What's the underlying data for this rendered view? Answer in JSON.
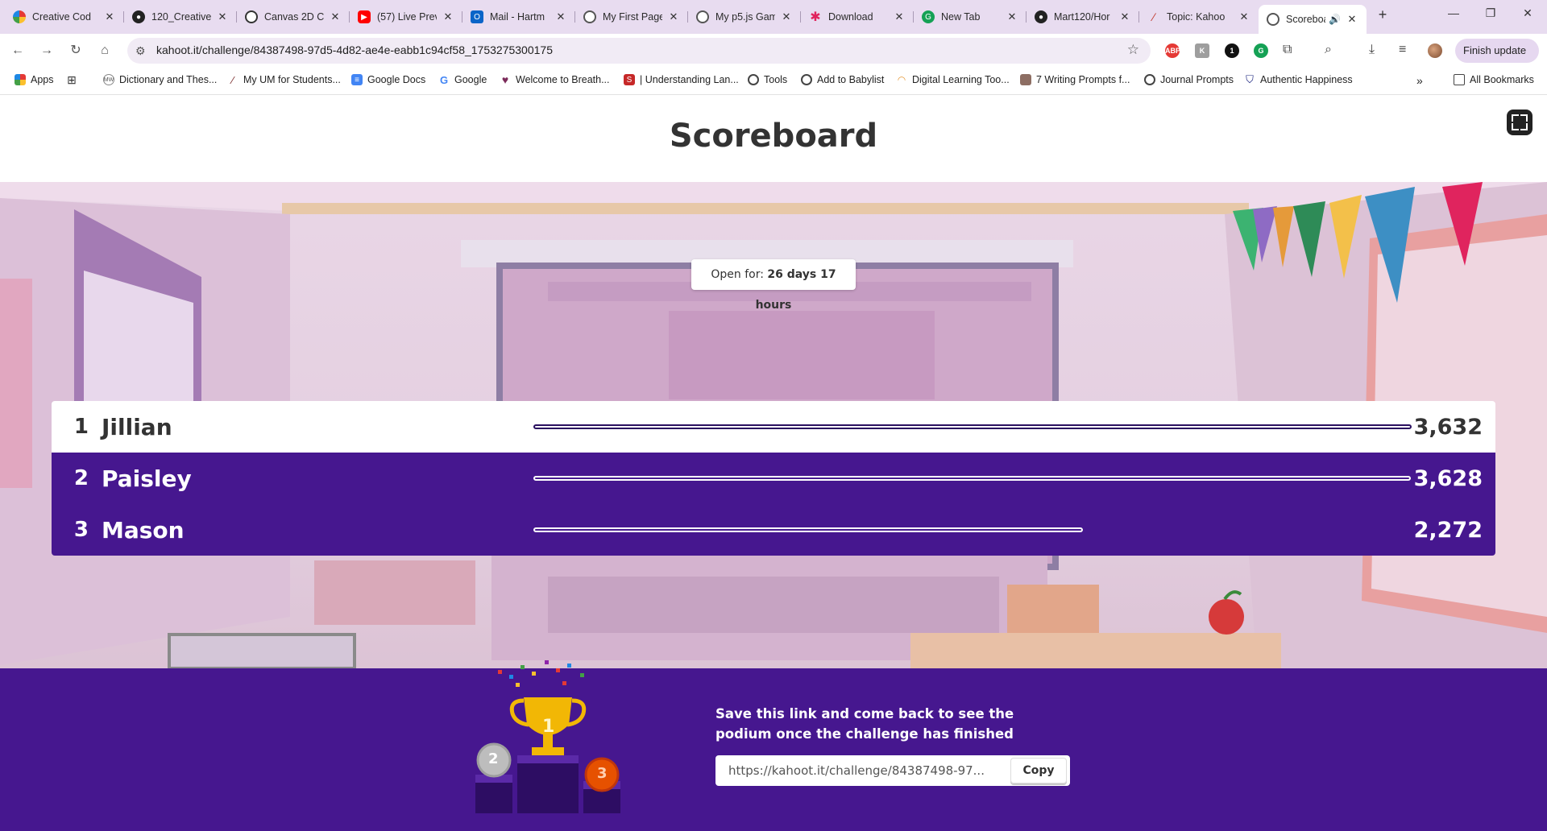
{
  "browser": {
    "tabs": [
      {
        "label": "Creative Cod",
        "icon": "multicolor-logo-icon",
        "color": "#e05a2b"
      },
      {
        "label": "120_Creative",
        "icon": "github-icon",
        "color": "#222222"
      },
      {
        "label": "Canvas 2D C",
        "icon": "openai-icon",
        "color": "#333333"
      },
      {
        "label": "(57) Live Prev",
        "icon": "youtube-icon",
        "color": "#ff0000"
      },
      {
        "label": "Mail - Hartm",
        "icon": "outlook-icon",
        "color": "#0a64c8"
      },
      {
        "label": "My First Page",
        "icon": "globe-icon",
        "color": "#444444"
      },
      {
        "label": "My p5.js Gam",
        "icon": "globe-icon",
        "color": "#444444"
      },
      {
        "label": "Download",
        "icon": "asterisk-icon",
        "color": "#e0245e"
      },
      {
        "label": "New Tab",
        "icon": "grammarly-icon",
        "color": "#15a155"
      },
      {
        "label": "Mart120/Hor",
        "icon": "github-icon",
        "color": "#222222"
      },
      {
        "label": "Topic: Kahoo",
        "icon": "canvas-icon",
        "color": "#c0392b"
      },
      {
        "label": "Scoreboa",
        "icon": "globe-icon",
        "color": "#444444",
        "active": true
      }
    ],
    "url": "kahoot.it/challenge/84387498-97d5-4d82-ae4e-eabb1c94cf58_1753275300175",
    "finish_update": "Finish update",
    "bookmarks": [
      {
        "label": "Apps",
        "icon": "apps-grid-icon"
      },
      {
        "label": "",
        "icon": "grid-icon"
      },
      {
        "label": "Dictionary and Thes...",
        "icon": "mw-icon"
      },
      {
        "label": "My UM for Students...",
        "icon": "um-icon"
      },
      {
        "label": "Google Docs",
        "icon": "docs-icon"
      },
      {
        "label": "Google",
        "icon": "google-icon"
      },
      {
        "label": "Welcome to Breath...",
        "icon": "heart-icon"
      },
      {
        "label": "| Understanding Lan...",
        "icon": "s-icon"
      },
      {
        "label": "Tools",
        "icon": "globe-icon"
      },
      {
        "label": "Add to Babylist",
        "icon": "globe-icon"
      },
      {
        "label": "Digital Learning Too...",
        "icon": "rainbow-icon"
      },
      {
        "label": "7 Writing Prompts f...",
        "icon": "photo-icon"
      },
      {
        "label": "Journal Prompts",
        "icon": "globe-icon"
      },
      {
        "label": "Authentic Happiness",
        "icon": "shield-icon"
      }
    ],
    "all_bookmarks": "All Bookmarks"
  },
  "page": {
    "title": "Scoreboard",
    "open_prefix": "Open for: ",
    "open_duration": "26 days 17 hours",
    "players": [
      {
        "rank": "1",
        "name": "Jillian",
        "score": "3,632",
        "fraction": 1.0
      },
      {
        "rank": "2",
        "name": "Paisley",
        "score": "3,628",
        "fraction": 0.999
      },
      {
        "rank": "3",
        "name": "Mason",
        "score": "2,272",
        "fraction": 0.626
      }
    ],
    "save_message": "Save this link and come back to see the podium once the challenge has finished",
    "link_value": "https://kahoot.it/challenge/84387498-97...",
    "copy_label": "Copy",
    "podium_labels": [
      "1",
      "2",
      "3"
    ]
  }
}
